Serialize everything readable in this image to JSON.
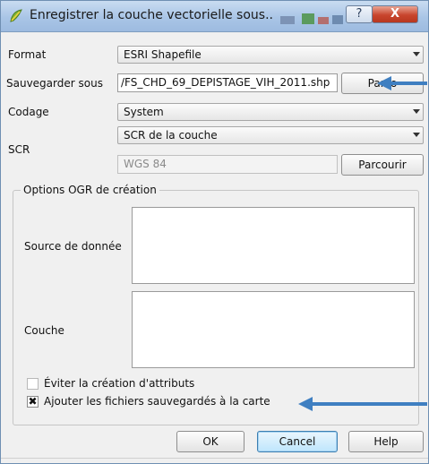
{
  "window": {
    "title": "Enregistrer la couche vectorielle sous..",
    "help_glyph": "?",
    "close_glyph": "X",
    "icon": "qgis-icon"
  },
  "form": {
    "format_label": "Format",
    "format_value": "ESRI Shapefile",
    "save_as_label": "Sauvegarder sous",
    "save_as_value": "/FS_CHD_69_DEPISTAGE_VIH_2011.shp",
    "browse_label": "Parcourir",
    "browse_visible_text": "Parco",
    "browse_tail": "r",
    "encoding_label": "Codage",
    "encoding_value": "System",
    "crs_label": "SCR",
    "crs_mode_value": "SCR de la couche",
    "crs_value": "WGS 84",
    "crs_browse_label": "Parcourir"
  },
  "ogr_options": {
    "title": "Options OGR de création",
    "datasource_label": "Source de donnée",
    "layer_label": "Couche"
  },
  "checkboxes": {
    "skip_attributes_label": "Éviter la création d'attributs",
    "skip_attributes_checked": false,
    "add_to_map_label": "Ajouter les fichiers sauvegardés à la carte",
    "add_to_map_checked": true,
    "check_glyph": "✖"
  },
  "buttons": {
    "ok_label": "OK",
    "cancel_label": "Cancel",
    "help_label": "Help"
  },
  "annotations": {
    "arrow_color": "#3f7fc1"
  }
}
